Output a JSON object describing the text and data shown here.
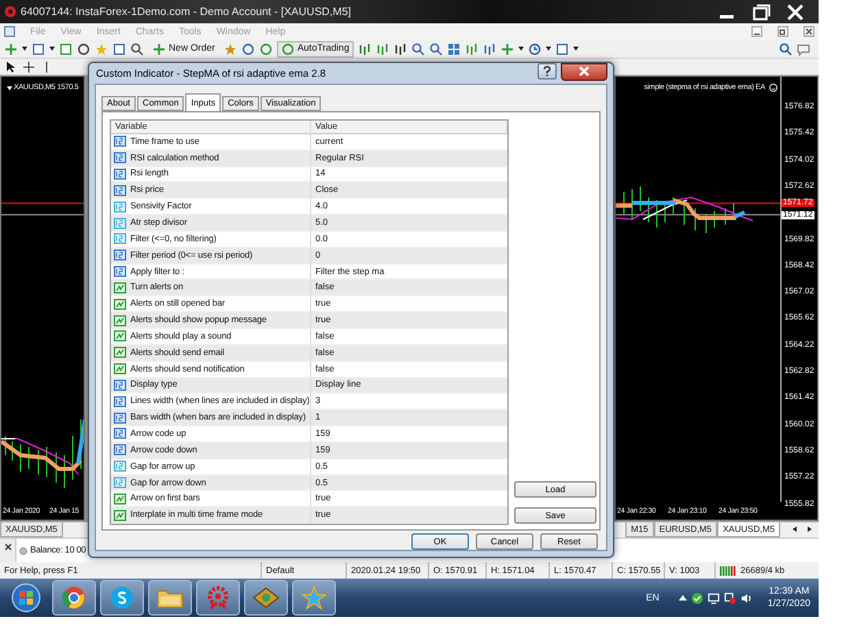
{
  "window": {
    "title": "64007144: InstaForex-1Demo.com - Demo Account - [XAUUSD,M5]"
  },
  "menu": [
    "File",
    "View",
    "Insert",
    "Charts",
    "Tools",
    "Window",
    "Help"
  ],
  "toolbar": {
    "new_order": "New Order",
    "autotrading": "AutoTrading"
  },
  "left_chart": {
    "header": "XAUUSD,M5  1570.5",
    "time_labels": [
      "24 Jan 2020",
      "24 Jan 15"
    ]
  },
  "right_chart": {
    "header": "simple (stepma of rsi adaptive ema) EA",
    "price_labels": [
      "1576.82",
      "1575.42",
      "1574.02",
      "1572.62",
      "1569.82",
      "1568.42",
      "1567.02",
      "1565.62",
      "1564.22",
      "1562.82",
      "1561.42",
      "1560.02",
      "1558.62",
      "1557.22",
      "1555.82"
    ],
    "price_tags": [
      {
        "kind": "bid",
        "label": "1571.72"
      },
      {
        "kind": "ask",
        "label": "1571.12"
      }
    ],
    "time_labels": [
      "24 Jan 22:30",
      "24 Jan 23:10",
      "24 Jan 23:50"
    ]
  },
  "chart_tabs": [
    {
      "label": "XAUUSD,M5",
      "selected": false
    },
    {
      "label": "M15",
      "selected": false
    },
    {
      "label": "EURUSD,M5",
      "selected": false
    },
    {
      "label": "XAUUSD,M5",
      "selected": true
    }
  ],
  "terminal": {
    "balance": "Balance: 10 00"
  },
  "status_bar": [
    "For Help, press F1",
    "Default",
    "2020.01.24 19:50",
    "O: 1570.91",
    "H: 1571.04",
    "L: 1570.47",
    "C: 1570.55",
    "V: 1003",
    "26689/4 kb"
  ],
  "taskbar": {
    "language": "EN",
    "time": "12:39 AM",
    "date": "1/27/2020"
  },
  "dialog": {
    "title": "Custom Indicator - StepMA of rsi adaptive ema 2.8",
    "tabs": [
      {
        "label": "About",
        "selected": false
      },
      {
        "label": "Common",
        "selected": false
      },
      {
        "label": "Inputs",
        "selected": true
      },
      {
        "label": "Colors",
        "selected": false
      },
      {
        "label": "Visualization",
        "selected": false
      }
    ],
    "columns": [
      "Variable",
      "Value"
    ],
    "rows": [
      {
        "kind": "int",
        "variable": "Time frame to use",
        "value": "current"
      },
      {
        "kind": "int",
        "variable": "RSI calculation method",
        "value": "Regular RSI"
      },
      {
        "kind": "int",
        "variable": "Rsi length",
        "value": "14"
      },
      {
        "kind": "int",
        "variable": "Rsi price",
        "value": "Close"
      },
      {
        "kind": "double",
        "variable": "Sensivity Factor",
        "value": "4.0"
      },
      {
        "kind": "double",
        "variable": "Atr step divisor",
        "value": "5.0"
      },
      {
        "kind": "double",
        "variable": "Filter (<=0, no filtering)",
        "value": "0.0"
      },
      {
        "kind": "int",
        "variable": "Filter period (0<= use rsi period)",
        "value": "0"
      },
      {
        "kind": "int",
        "variable": "Apply filter to :",
        "value": "Filter the step ma"
      },
      {
        "kind": "bool",
        "variable": "Turn alerts on",
        "value": "false"
      },
      {
        "kind": "bool",
        "variable": "Alerts on still opened bar",
        "value": "true"
      },
      {
        "kind": "bool",
        "variable": "Alerts should show popup message",
        "value": "true"
      },
      {
        "kind": "bool",
        "variable": "Alerts should play a sound",
        "value": "false"
      },
      {
        "kind": "bool",
        "variable": "Alerts should send email",
        "value": "false"
      },
      {
        "kind": "bool",
        "variable": "Alerts should send notification",
        "value": "false"
      },
      {
        "kind": "int",
        "variable": "Display type",
        "value": "Display line"
      },
      {
        "kind": "int",
        "variable": "Lines width (when lines are included in display)",
        "value": "3"
      },
      {
        "kind": "int",
        "variable": "Bars width (when bars are included in display)",
        "value": "1"
      },
      {
        "kind": "int",
        "variable": "Arrow code up",
        "value": "159"
      },
      {
        "kind": "int",
        "variable": "Arrow code down",
        "value": "159"
      },
      {
        "kind": "double",
        "variable": "Gap for arrow up",
        "value": "0.5"
      },
      {
        "kind": "double",
        "variable": "Gap for arrow down",
        "value": "0.5"
      },
      {
        "kind": "bool",
        "variable": "Arrow on first bars",
        "value": "true"
      },
      {
        "kind": "bool",
        "variable": "Interplate in multi time frame mode",
        "value": "true"
      }
    ],
    "side_buttons": [
      "Load",
      "Save"
    ],
    "buttons": [
      "OK",
      "Cancel",
      "Reset"
    ]
  }
}
